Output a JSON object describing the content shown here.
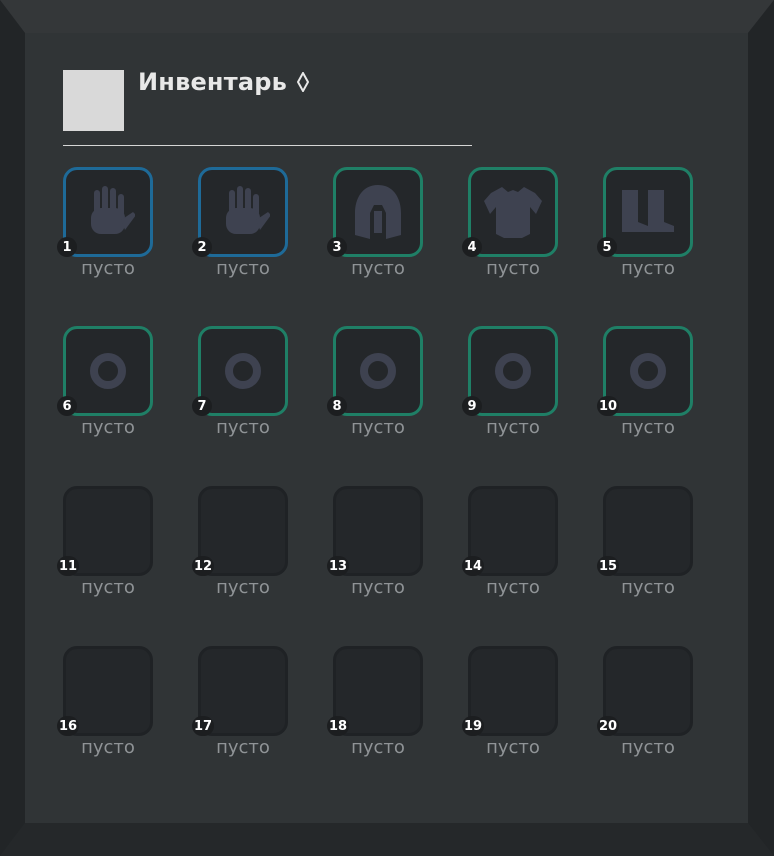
{
  "inventory": {
    "title": "Инвентарь",
    "title_icon": "diamond-icon",
    "colors": {
      "hands": "#1e6a98",
      "gear": "#1f7f66",
      "empty_border": "#1f2225",
      "icon_fill": "#3e4250",
      "slot_bg": "#24272a"
    },
    "slots": [
      {
        "num": "1",
        "label": "пусто",
        "type": "hands",
        "icon": "hand-icon"
      },
      {
        "num": "2",
        "label": "пусто",
        "type": "hands",
        "icon": "hand-icon"
      },
      {
        "num": "3",
        "label": "пусто",
        "type": "gear",
        "icon": "helmet-icon"
      },
      {
        "num": "4",
        "label": "пусто",
        "type": "gear",
        "icon": "armor-icon"
      },
      {
        "num": "5",
        "label": "пусто",
        "type": "gear",
        "icon": "boots-icon"
      },
      {
        "num": "6",
        "label": "пусто",
        "type": "gear",
        "icon": "ring-icon"
      },
      {
        "num": "7",
        "label": "пусто",
        "type": "gear",
        "icon": "ring-icon"
      },
      {
        "num": "8",
        "label": "пусто",
        "type": "gear",
        "icon": "ring-icon"
      },
      {
        "num": "9",
        "label": "пусто",
        "type": "gear",
        "icon": "ring-icon"
      },
      {
        "num": "10",
        "label": "пусто",
        "type": "gear",
        "icon": "ring-icon"
      },
      {
        "num": "11",
        "label": "пусто",
        "type": "empty",
        "icon": ""
      },
      {
        "num": "12",
        "label": "пусто",
        "type": "empty",
        "icon": ""
      },
      {
        "num": "13",
        "label": "пусто",
        "type": "empty",
        "icon": ""
      },
      {
        "num": "14",
        "label": "пусто",
        "type": "empty",
        "icon": ""
      },
      {
        "num": "15",
        "label": "пусто",
        "type": "empty",
        "icon": ""
      },
      {
        "num": "16",
        "label": "пусто",
        "type": "empty",
        "icon": ""
      },
      {
        "num": "17",
        "label": "пусто",
        "type": "empty",
        "icon": ""
      },
      {
        "num": "18",
        "label": "пусто",
        "type": "empty",
        "icon": ""
      },
      {
        "num": "19",
        "label": "пусто",
        "type": "empty",
        "icon": ""
      },
      {
        "num": "20",
        "label": "пусто",
        "type": "empty",
        "icon": ""
      }
    ]
  }
}
